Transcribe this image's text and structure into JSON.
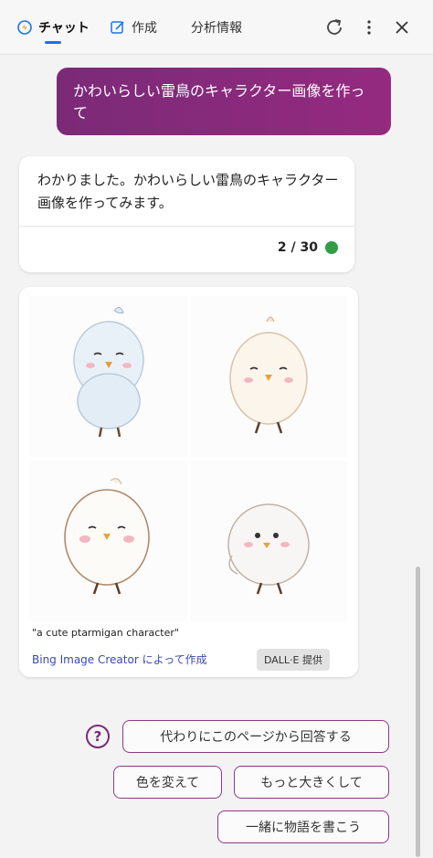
{
  "tabs": [
    {
      "label": "チャット"
    },
    {
      "label": "作成"
    },
    {
      "label": "分析情報"
    }
  ],
  "colors": {
    "accent": "#1a73e8",
    "user_bubble": "#8a2a7c",
    "status_dot": "#2f9e44",
    "link": "#3949b3"
  },
  "conversation": {
    "user_message": "かわいらしい雷鳥のキャラクター画像を作って",
    "bot_message": "わかりました。かわいらしい雷鳥のキャラクター画像を作ってみます。",
    "counter": "2 / 30"
  },
  "image_result": {
    "caption": "\"a cute ptarmigan character\"",
    "creator_link": "Bing Image Creator によって作成",
    "badge": "DALL·E 提供"
  },
  "suggestions": [
    {
      "label": "代わりにこのページから回答する"
    },
    {
      "label": "色を変えて"
    },
    {
      "label": "もっと大きくして"
    },
    {
      "label": "一緒に物語を書こう"
    }
  ],
  "icons": [
    "chat-icon",
    "compose-icon",
    "refresh-icon",
    "more-icon",
    "close-icon",
    "help-icon"
  ]
}
